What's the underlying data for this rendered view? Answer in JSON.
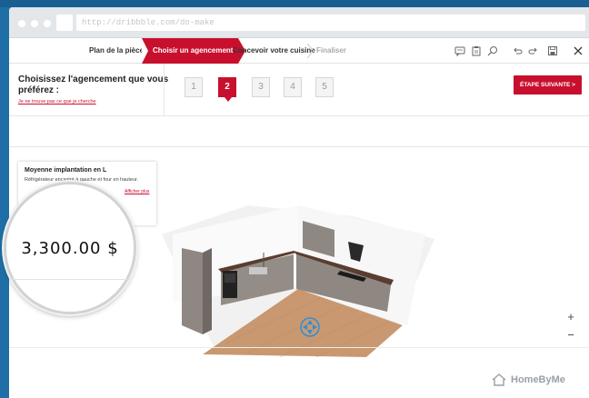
{
  "browser": {
    "url": "http://dribbble.com/do-make"
  },
  "steps": {
    "items": [
      {
        "label": "Plan de la pièce",
        "state": "done"
      },
      {
        "label": "Choisir un agencement",
        "state": "active"
      },
      {
        "label": "Concevoir votre cuisine",
        "state": "next"
      },
      {
        "label": "Finaliser",
        "state": "future"
      }
    ]
  },
  "toolbar": {
    "icons": [
      "comment-icon",
      "clipboard-icon",
      "search-zoom-icon",
      "undo-icon",
      "redo-icon",
      "save-icon",
      "close-icon"
    ]
  },
  "header": {
    "question": "Choisissez l'agencement que vous préférez :",
    "help_link": "Je ne trouve pas ce que je cherche",
    "layout_numbers": [
      "1",
      "2",
      "3",
      "4",
      "5"
    ],
    "selected_layout": "2",
    "next_button": "ÉTAPE SUIVANTE >"
  },
  "card": {
    "title": "Moyenne implantation en L",
    "description": "Réfrigérateur encastré à gauche et four en hauteur.",
    "link": "Afficher plus"
  },
  "price": "3,300.00 $",
  "zoom": {
    "plus": "+",
    "minus": "−"
  },
  "brand": {
    "name": "HomeByMe"
  },
  "colors": {
    "accent": "#c8102e",
    "background": "#1f6fa6"
  }
}
